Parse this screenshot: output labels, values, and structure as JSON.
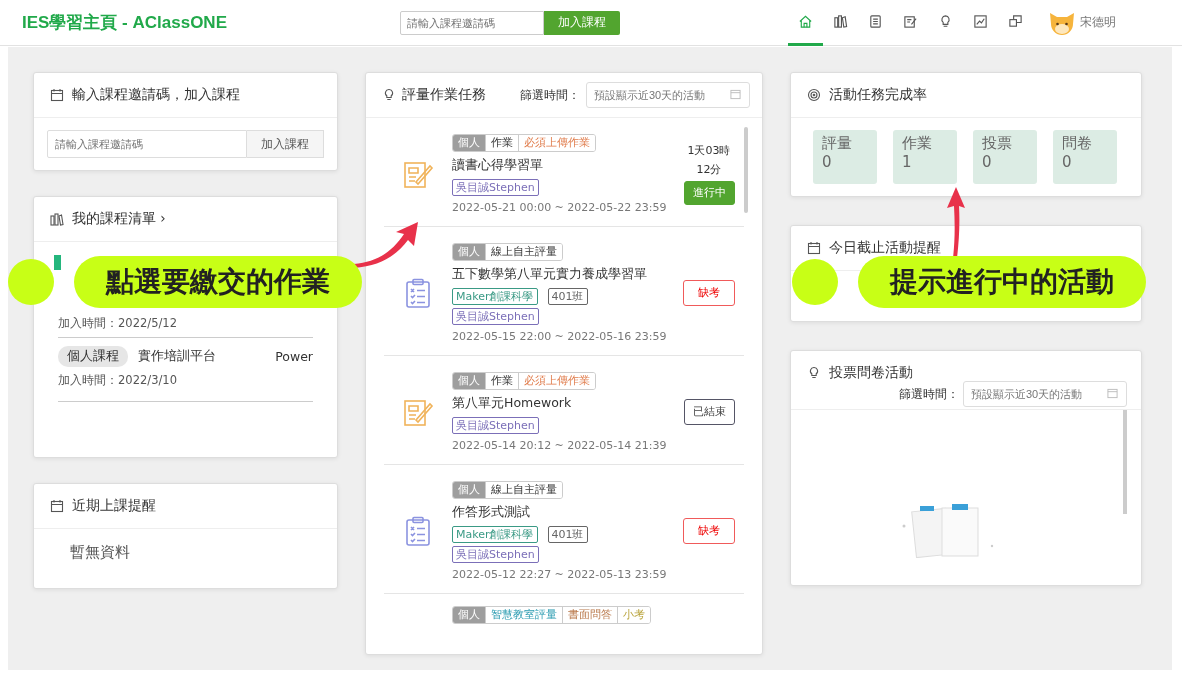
{
  "header": {
    "title": "IES學習主頁 - AClassONE",
    "invite": {
      "placeholder": "請輸入課程邀請碼",
      "button": "加入課程"
    },
    "nav": [
      {
        "selected": true
      },
      {
        "selected": false
      },
      {
        "selected": false
      },
      {
        "selected": false
      },
      {
        "selected": false
      },
      {
        "selected": false
      },
      {
        "selected": false
      }
    ],
    "user": "宋德明"
  },
  "join_card": {
    "title": "輸入課程邀請碼，加入課程",
    "placeholder": "請輸入課程邀請碼",
    "button": "加入課程"
  },
  "courses_card": {
    "title": "我的課程清單 ›",
    "courses": [
      {
        "joined": "加入時間：2022/5/12"
      },
      {
        "tag": "個人課程",
        "name": "實作培訓平台",
        "teacher": "Power",
        "joined": "加入時間：2022/3/10"
      }
    ]
  },
  "upcoming_card": {
    "title": "近期上課提醒",
    "empty": "暫無資料"
  },
  "tasks_card": {
    "title": "評量作業任務",
    "filter_label": "篩選時間：",
    "filter_placeholder": "預設顯示近30天的活動",
    "tasks": [
      {
        "kind": "homework",
        "tags": [
          {
            "label": "個人",
            "kind": "scope"
          },
          {
            "label": "作業",
            "kind": "type"
          },
          {
            "label": "必須上傳作業",
            "kind": "upload"
          }
        ],
        "title": "讀書心得學習單",
        "chips": [
          {
            "label": "吳目誠Stephen",
            "color": "#7b6fb8"
          }
        ],
        "dates": "2022-05-21 00:00 ~ 2022-05-22 23:59",
        "countdown": [
          "1天03時",
          "12分"
        ],
        "status": {
          "label": "進行中",
          "kind": "ongoing"
        }
      },
      {
        "kind": "quiz",
        "tags": [
          {
            "label": "個人",
            "kind": "scope"
          },
          {
            "label": "線上自主評量",
            "kind": "type"
          }
        ],
        "title": "五下數學第八單元實力養成學習單",
        "chips": [
          {
            "label": "Maker創課科學",
            "color": "#3a9a85"
          },
          {
            "label": "401班",
            "color": "#666666"
          },
          {
            "label": "吳目誠Stephen",
            "color": "#7b6fb8"
          }
        ],
        "dates": "2022-05-15 22:00 ~ 2022-05-16 23:59",
        "status": {
          "label": "缺考",
          "kind": "absent"
        }
      },
      {
        "kind": "homework",
        "tags": [
          {
            "label": "個人",
            "kind": "scope"
          },
          {
            "label": "作業",
            "kind": "type"
          },
          {
            "label": "必須上傳作業",
            "kind": "upload"
          }
        ],
        "title": "第八單元Homework",
        "chips": [
          {
            "label": "吳目誠Stephen",
            "color": "#7b6fb8"
          }
        ],
        "dates": "2022-05-14 20:12 ~ 2022-05-14 21:39",
        "status": {
          "label": "已結束",
          "kind": "ended"
        }
      },
      {
        "kind": "quiz",
        "tags": [
          {
            "label": "個人",
            "kind": "scope"
          },
          {
            "label": "線上自主評量",
            "kind": "type"
          }
        ],
        "title": "作答形式測試",
        "chips": [
          {
            "label": "Maker創課科學",
            "color": "#3a9a85"
          },
          {
            "label": "401班",
            "color": "#666666"
          },
          {
            "label": "吳目誠Stephen",
            "color": "#7b6fb8"
          }
        ],
        "dates": "2022-05-12 22:27 ~ 2022-05-13 23:59",
        "status": {
          "label": "缺考",
          "kind": "absent"
        }
      },
      {
        "kind": "cut",
        "tags": [
          {
            "label": "個人",
            "kind": "scope"
          },
          {
            "label": "智慧教室評量",
            "kind": "smart"
          },
          {
            "label": "書面問答",
            "kind": "written"
          },
          {
            "label": "小考",
            "kind": "test"
          }
        ]
      }
    ]
  },
  "completion_card": {
    "title": "活動任務完成率",
    "stats": [
      {
        "label": "評量",
        "value": "0"
      },
      {
        "label": "作業",
        "value": "1"
      },
      {
        "label": "投票",
        "value": "0"
      },
      {
        "label": "問卷",
        "value": "0"
      }
    ]
  },
  "due_today_card": {
    "title": "今日截止活動提醒"
  },
  "poll_card": {
    "title": "投票問卷活動",
    "filter_label": "篩選時間：",
    "filter_placeholder": "預設顯示近30天的活動"
  },
  "annotations": [
    {
      "text": "點選要繳交的作業"
    },
    {
      "text": "提示進行中的活動"
    }
  ]
}
